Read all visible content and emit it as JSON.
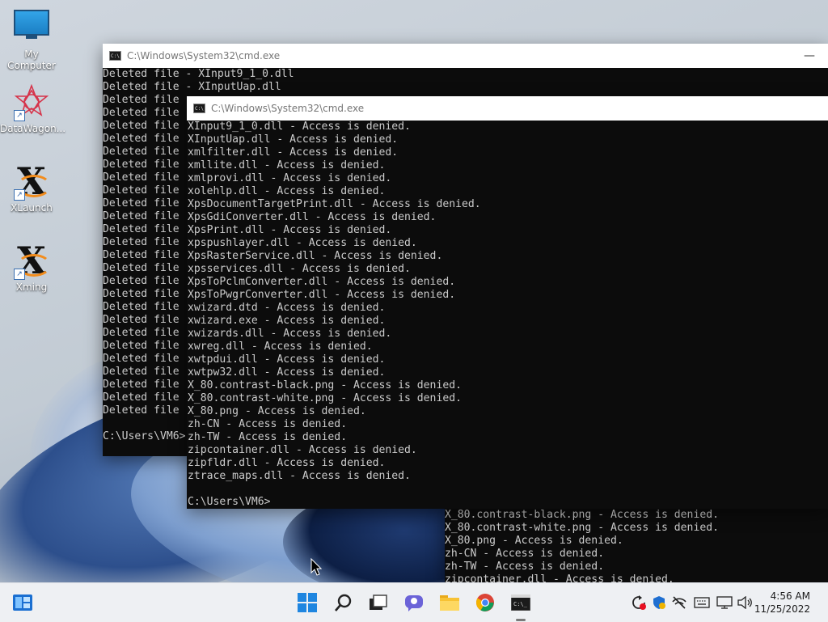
{
  "desktop": {
    "icons": [
      {
        "label": "My Computer"
      },
      {
        "label": "DataWagon..."
      },
      {
        "label": "XLaunch"
      },
      {
        "label": "Xming"
      }
    ]
  },
  "back_window": {
    "title": "C:\\Windows\\System32\\cmd.exe",
    "lines": [
      "Deleted file - XInput9_1_0.dll",
      "Deleted file - XInputUap.dll",
      "Deleted file",
      "Deleted file",
      "Deleted file",
      "Deleted file",
      "Deleted file",
      "Deleted file",
      "Deleted file",
      "Deleted file",
      "Deleted file",
      "Deleted file",
      "Deleted file",
      "Deleted file",
      "Deleted file",
      "Deleted file",
      "Deleted file",
      "Deleted file",
      "Deleted file",
      "Deleted file",
      "Deleted file",
      "Deleted file",
      "Deleted file",
      "Deleted file",
      "Deleted file",
      "Deleted file",
      "Deleted file",
      "",
      "C:\\Users\\VM6>"
    ]
  },
  "front_window": {
    "title": "C:\\Windows\\System32\\cmd.exe",
    "lines": [
      "XInput9_1_0.dll - Access is denied.",
      "XInputUap.dll - Access is denied.",
      "xmlfilter.dll - Access is denied.",
      "xmllite.dll - Access is denied.",
      "xmlprovi.dll - Access is denied.",
      "xolehlp.dll - Access is denied.",
      "XpsDocumentTargetPrint.dll - Access is denied.",
      "XpsGdiConverter.dll - Access is denied.",
      "XpsPrint.dll - Access is denied.",
      "xpspushlayer.dll - Access is denied.",
      "XpsRasterService.dll - Access is denied.",
      "xpsservices.dll - Access is denied.",
      "XpsToPclmConverter.dll - Access is denied.",
      "XpsToPwgrConverter.dll - Access is denied.",
      "xwizard.dtd - Access is denied.",
      "xwizard.exe - Access is denied.",
      "xwizards.dll - Access is denied.",
      "xwreg.dll - Access is denied.",
      "xwtpdui.dll - Access is denied.",
      "xwtpw32.dll - Access is denied.",
      "X_80.contrast-black.png - Access is denied.",
      "X_80.contrast-white.png - Access is denied.",
      "X_80.png - Access is denied.",
      "zh-CN - Access is denied.",
      "zh-TW - Access is denied.",
      "zipcontainer.dll - Access is denied.",
      "zipfldr.dll - Access is denied.",
      "ztrace_maps.dll - Access is denied.",
      "",
      "C:\\Users\\VM6>"
    ]
  },
  "bottom_window": {
    "lines": [
      "X_80.contrast-black.png - Access is denied.",
      "X_80.contrast-white.png - Access is denied.",
      "X_80.png - Access is denied.",
      "zh-CN - Access is denied.",
      "zh-TW - Access is denied.",
      "zipcontainer.dll - Access is denied."
    ]
  },
  "taskbar": {
    "items": [
      "widgets-icon",
      "start-icon",
      "search-icon",
      "task-view-icon",
      "chat-icon",
      "file-explorer-icon",
      "chrome-icon",
      "terminal-icon"
    ],
    "tray": [
      "update-icon",
      "defender-icon",
      "network-off-icon",
      "keyboard-icon",
      "projector-icon",
      "volume-icon"
    ],
    "time": "4:56 AM",
    "date": "11/25/2022"
  },
  "colors": {
    "terminal_bg": "#0c0c0c",
    "terminal_fg": "#cccccc",
    "taskbar_bg": "#eef0f3",
    "accent": "#0078d4"
  }
}
